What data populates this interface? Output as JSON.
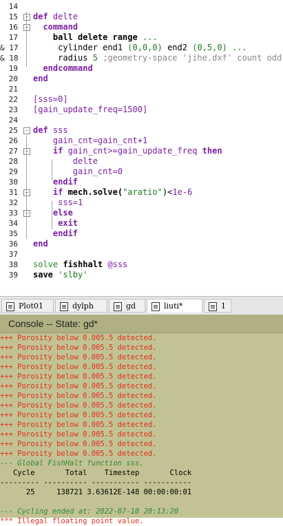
{
  "editor": {
    "lines": [
      {
        "n": "14",
        "code": []
      },
      {
        "n": "15",
        "code": [
          {
            "t": "def",
            "c": "k-purple"
          },
          {
            "t": " delte",
            "c": "k-fn"
          }
        ]
      },
      {
        "n": "16",
        "code": [
          {
            "t": "  command",
            "c": "k-purple"
          }
        ]
      },
      {
        "n": "17",
        "code": [
          {
            "t": "    ball delete range",
            "c": "k-bold"
          },
          {
            "t": " ...",
            "c": "k-num"
          }
        ]
      },
      {
        "n": "& 17",
        "code": [
          {
            "t": "     cylinder end1 ",
            "c": "k-black"
          },
          {
            "t": "(0,0,0)",
            "c": "k-num"
          },
          {
            "t": " end2 ",
            "c": "k-black"
          },
          {
            "t": "(0,5,0)",
            "c": "k-num"
          },
          {
            "t": " ...",
            "c": "k-num"
          }
        ]
      },
      {
        "n": "& 18",
        "code": [
          {
            "t": "     radius ",
            "c": "k-black"
          },
          {
            "t": "5",
            "c": "k-num"
          },
          {
            "t": " ;geometry-space 'jihe.dxf' count odd",
            "c": "k-cmt"
          }
        ]
      },
      {
        "n": "19",
        "code": [
          {
            "t": "  endcommand",
            "c": "k-purple"
          }
        ]
      },
      {
        "n": "20",
        "code": [
          {
            "t": "end",
            "c": "k-purple"
          }
        ]
      },
      {
        "n": "21",
        "code": []
      },
      {
        "n": "22",
        "code": [
          {
            "t": "[sss=0]",
            "c": "k-fn"
          }
        ]
      },
      {
        "n": "23",
        "code": [
          {
            "t": "[gain_update_freq=1500]",
            "c": "k-fn"
          }
        ]
      },
      {
        "n": "24",
        "code": []
      },
      {
        "n": "25",
        "code": [
          {
            "t": "def",
            "c": "k-purple"
          },
          {
            "t": " sss",
            "c": "k-fn"
          }
        ]
      },
      {
        "n": "26",
        "code": [
          {
            "t": "    gain_cnt=gain_cnt+1",
            "c": "k-fn"
          }
        ]
      },
      {
        "n": "27",
        "code": [
          {
            "t": "    if",
            "c": "k-purple"
          },
          {
            "t": " gain_cnt>=gain_update_freq ",
            "c": "k-fn"
          },
          {
            "t": "then",
            "c": "k-purple"
          }
        ]
      },
      {
        "n": "28",
        "code": [
          {
            "t": "        delte",
            "c": "k-fn"
          }
        ]
      },
      {
        "n": "29",
        "code": [
          {
            "t": "        gain_cnt=0",
            "c": "k-fn"
          }
        ]
      },
      {
        "n": "30",
        "code": [
          {
            "t": "    endif",
            "c": "k-purple"
          }
        ]
      },
      {
        "n": "31",
        "code": [
          {
            "t": "    if",
            "c": "k-purple"
          },
          {
            "t": " mech.solve(",
            "c": "k-bold"
          },
          {
            "t": "\"aratio\"",
            "c": "k-num"
          },
          {
            "t": ")<",
            "c": "k-black"
          },
          {
            "t": "1e-6",
            "c": "k-fn"
          }
        ]
      },
      {
        "n": "32",
        "code": [
          {
            "t": "     sss=1",
            "c": "k-fn"
          }
        ]
      },
      {
        "n": "33",
        "code": [
          {
            "t": "    else",
            "c": "k-purple"
          }
        ]
      },
      {
        "n": "34",
        "code": [
          {
            "t": "     exit",
            "c": "k-purple"
          }
        ]
      },
      {
        "n": "35",
        "code": [
          {
            "t": "    endif",
            "c": "k-purple"
          }
        ]
      },
      {
        "n": "36",
        "code": [
          {
            "t": "end",
            "c": "k-purple"
          }
        ]
      },
      {
        "n": "37",
        "code": []
      },
      {
        "n": "38",
        "code": [
          {
            "t": "solve",
            "c": "k-green"
          },
          {
            "t": " fishhalt ",
            "c": "k-bold"
          },
          {
            "t": "@sss",
            "c": "k-fn"
          }
        ]
      },
      {
        "n": "39",
        "code": [
          {
            "t": "save ",
            "c": "k-bold"
          },
          {
            "t": "'slby'",
            "c": "k-num"
          }
        ]
      }
    ]
  },
  "tabs": [
    {
      "label": "Plot01",
      "active": false
    },
    {
      "label": "dylph",
      "active": false
    },
    {
      "label": "gd",
      "active": false
    },
    {
      "label": "liuti*",
      "active": true
    },
    {
      "label": "1",
      "active": false
    }
  ],
  "console": {
    "title": "Console -- State: gd*",
    "lines": [
      {
        "t": "+++ Porosity below 0.005.5 detected.",
        "c": "c-red"
      },
      {
        "t": "+++ Porosity below 0.005.5 detected.",
        "c": "c-red"
      },
      {
        "t": "+++ Porosity below 0.005.5 detected.",
        "c": "c-red"
      },
      {
        "t": "+++ Porosity below 0.005.5 detected.",
        "c": "c-red"
      },
      {
        "t": "+++ Porosity below 0.005.5 detected.",
        "c": "c-red"
      },
      {
        "t": "+++ Porosity below 0.005.5 detected.",
        "c": "c-red"
      },
      {
        "t": "+++ Porosity below 0.005.5 detected.",
        "c": "c-red"
      },
      {
        "t": "+++ Porosity below 0.005.5 detected.",
        "c": "c-red"
      },
      {
        "t": "+++ Porosity below 0.005.5 detected.",
        "c": "c-red"
      },
      {
        "t": "+++ Porosity below 0.005.5 detected.",
        "c": "c-red"
      },
      {
        "t": "+++ Porosity below 0.005.5 detected.",
        "c": "c-red"
      },
      {
        "t": "+++ Porosity below 0.005.5 detected.",
        "c": "c-red"
      },
      {
        "t": "+++ Porosity below 0.005.5 detected.",
        "c": "c-red"
      },
      {
        "t": "--- Global FishHalt function sss.",
        "c": "c-green"
      },
      {
        "t": "   Cycle       Total    Timestep       Clock",
        "c": "c-black"
      },
      {
        "t": "--------- ---------- ----------- -----------",
        "c": "c-black"
      },
      {
        "t": "      25     138721 3.63612E-148 00:00:00:01",
        "c": "c-black"
      },
      {
        "t": "",
        "c": "c-black"
      },
      {
        "t": "--- Cycling ended at: 2022-07-10 20:13:20",
        "c": "c-green"
      },
      {
        "t": "*** Illegal floating point value.",
        "c": "c-red"
      }
    ]
  },
  "colors": {
    "console_bg": "#c2c294",
    "error": "#e0301e",
    "keyword": "#7a1fa2",
    "comment": "#888888",
    "number": "#1f7a1f"
  }
}
